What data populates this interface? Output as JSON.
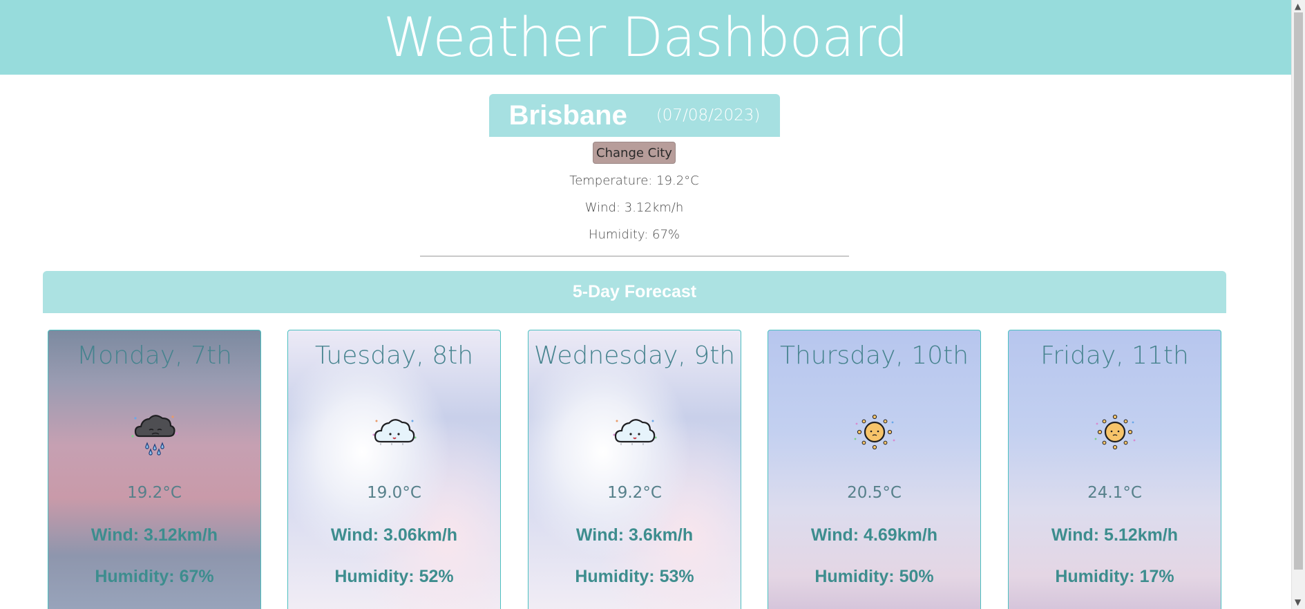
{
  "header": {
    "title": "Weather Dashboard"
  },
  "current": {
    "city": "Brisbane",
    "date": "(07/08/2023)",
    "change_city_label": "Change City",
    "temperature": "Temperature: 19.2°C",
    "wind": "Wind: 3.12km/h",
    "humidity": "Humidity: 67%"
  },
  "forecast": {
    "heading": "5-Day Forecast",
    "days": [
      {
        "day": "Monday, 7th",
        "icon": "rain-cloud-icon",
        "temp": "19.2°C",
        "wind": "Wind: 3.12km/h",
        "humidity": "Humidity: 67%"
      },
      {
        "day": "Tuesday, 8th",
        "icon": "cloud-icon",
        "temp": "19.0°C",
        "wind": "Wind: 3.06km/h",
        "humidity": "Humidity: 52%"
      },
      {
        "day": "Wednesday, 9th",
        "icon": "cloud-icon",
        "temp": "19.2°C",
        "wind": "Wind: 3.6km/h",
        "humidity": "Humidity: 53%"
      },
      {
        "day": "Thursday, 10th",
        "icon": "sun-icon",
        "temp": "20.5°C",
        "wind": "Wind: 4.69km/h",
        "humidity": "Humidity: 50%"
      },
      {
        "day": "Friday, 11th",
        "icon": "sun-icon",
        "temp": "24.1°C",
        "wind": "Wind: 5.12km/h",
        "humidity": "Humidity: 17%"
      }
    ]
  },
  "colors": {
    "header_bg": "#97dcdc",
    "banner_bg": "#a6e0e1",
    "button_bg": "#b79d9a",
    "card_text": "#3d8d8e",
    "card_border": "#4cc0c0"
  }
}
